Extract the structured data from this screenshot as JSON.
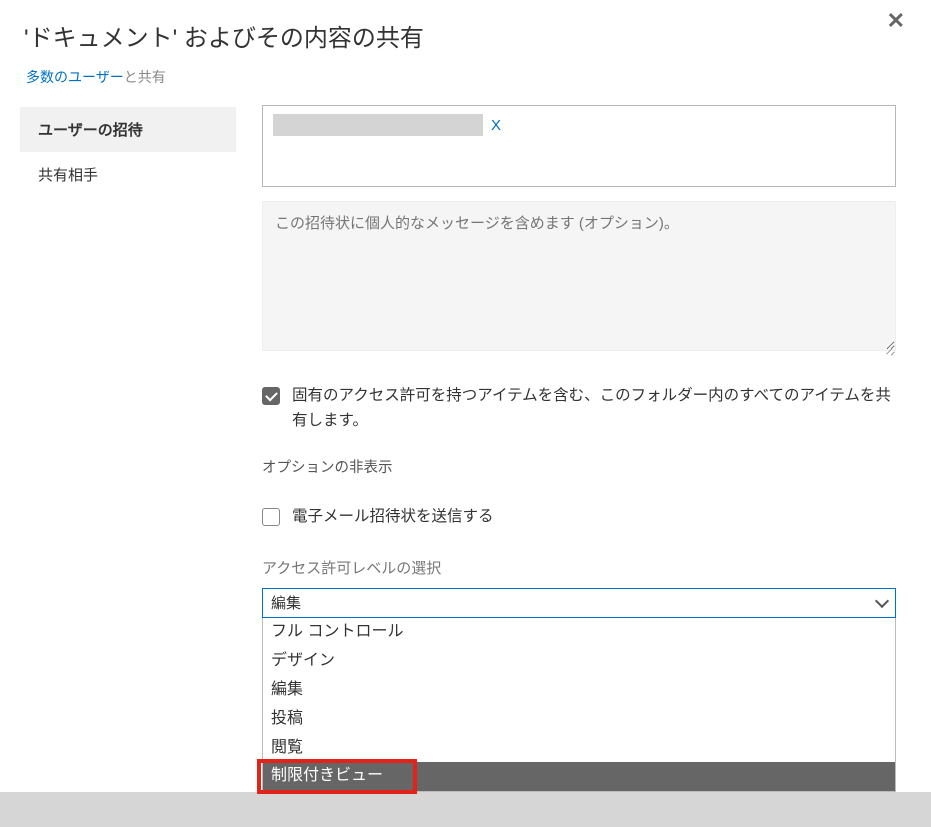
{
  "dialog": {
    "title": "'ドキュメント' およびその内容の共有",
    "close_glyph": "✕"
  },
  "breadcrumb": {
    "link_text": "多数のユーザー",
    "suffix_text": "と共有"
  },
  "sidebar": {
    "items": [
      {
        "label": "ユーザーの招待",
        "active": true
      },
      {
        "label": "共有相手",
        "active": false
      }
    ]
  },
  "invite_form": {
    "recipients": [
      {
        "display": "",
        "remove_glyph": "X"
      }
    ],
    "message_placeholder": "この招待状に個人的なメッセージを含めます (オプション)。",
    "inherit_checkbox": {
      "checked": true,
      "label": "固有のアクセス許可を持つアイテムを含む、このフォルダー内のすべてのアイテムを共有します。"
    },
    "hide_options_link": "オプションの非表示",
    "email_checkbox": {
      "checked": false,
      "label": "電子メール招待状を送信する"
    },
    "permission_label": "アクセス許可レベルの選択",
    "permission_selected": "編集",
    "permission_options": [
      "フル コントロール",
      "デザイン",
      "編集",
      "投稿",
      "閲覧",
      "制限付きビュー"
    ],
    "highlighted_option_index": 5
  }
}
